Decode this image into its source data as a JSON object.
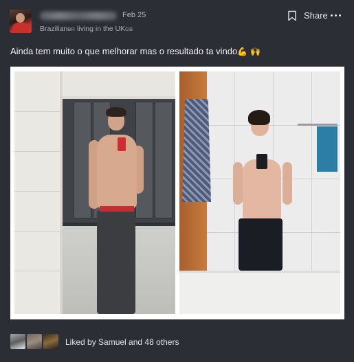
{
  "post": {
    "author_name": "",
    "date": "Feb 25",
    "subtitle_main": "Brazilian",
    "subtitle_flag1": "BR",
    "subtitle_rest": " living in the UK",
    "subtitle_flag2": "GB",
    "share_label": "Share",
    "caption_text": "Ainda tem muito o que melhorar mas o resultado ta vindo",
    "caption_emoji": "💪 🙌"
  },
  "likes": {
    "text": "Liked by Samuel and 48 others"
  },
  "icons": {
    "bookmark": "bookmark-icon",
    "more": "more-options-icon"
  },
  "colors": {
    "background": "#2b2e35",
    "text_primary": "#f1f2f4",
    "text_secondary": "#a9acb2"
  }
}
